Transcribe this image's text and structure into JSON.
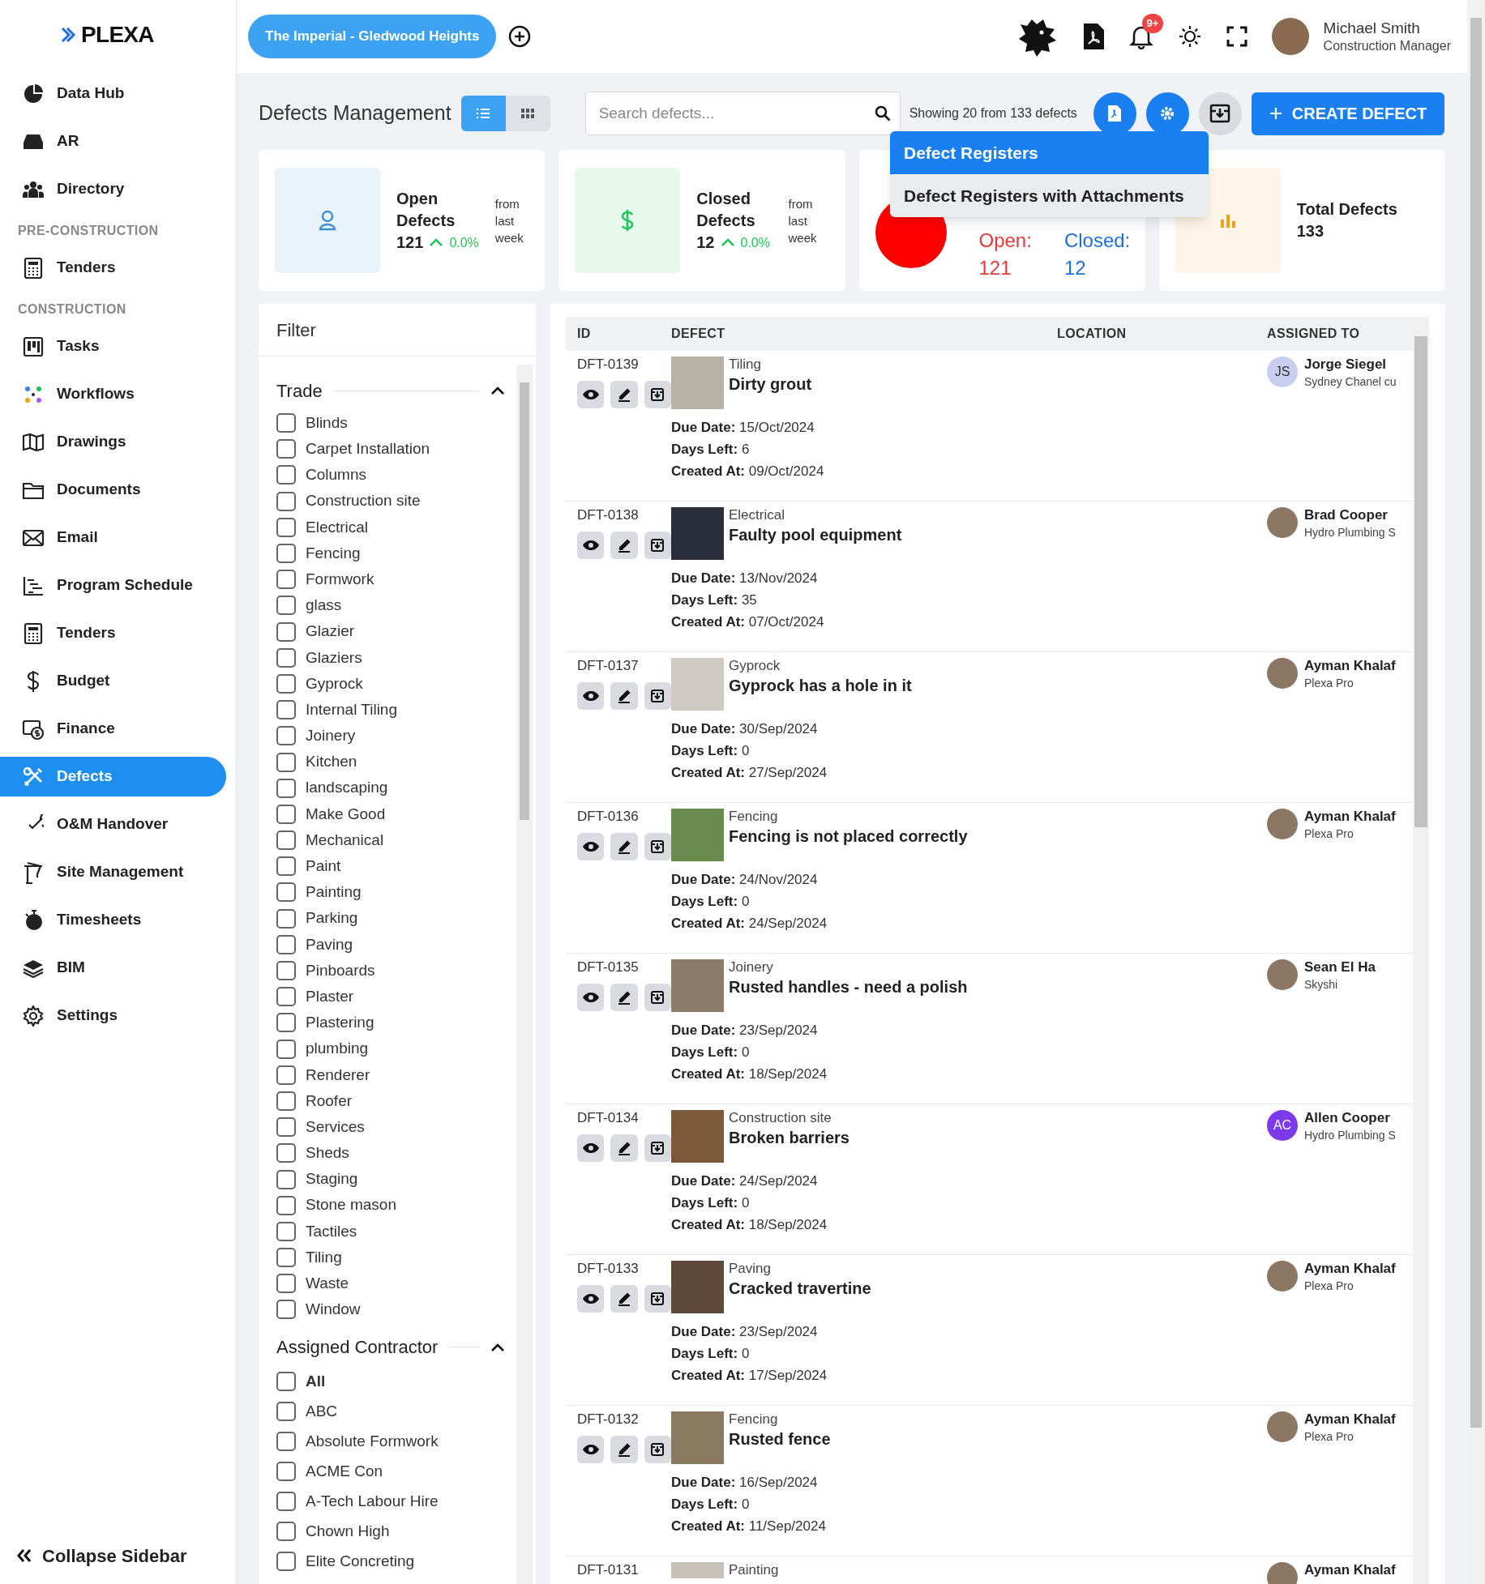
{
  "sidebar": {
    "logo": "PLEXA",
    "groups": [
      {
        "items": [
          {
            "label": "Data Hub",
            "selected": false
          },
          {
            "label": "AR",
            "selected": false
          },
          {
            "label": "Directory",
            "selected": false
          }
        ]
      },
      {
        "heading": "PRE-CONSTRUCTION",
        "items": [
          {
            "label": "Tenders",
            "selected": false
          }
        ]
      },
      {
        "heading": "CONSTRUCTION",
        "items": [
          {
            "label": "Tasks",
            "selected": false
          },
          {
            "label": "Workflows",
            "selected": false
          },
          {
            "label": "Drawings",
            "selected": false
          },
          {
            "label": "Documents",
            "selected": false
          },
          {
            "label": "Email",
            "selected": false
          },
          {
            "label": "Program Schedule",
            "selected": false
          },
          {
            "label": "Tenders",
            "selected": false
          },
          {
            "label": "Budget",
            "selected": false
          },
          {
            "label": "Finance",
            "selected": false
          },
          {
            "label": "Defects",
            "selected": true
          },
          {
            "label": "O&M Handover",
            "selected": false
          },
          {
            "label": "Site Management",
            "selected": false
          },
          {
            "label": "Timesheets",
            "selected": false
          },
          {
            "label": "BIM",
            "selected": false
          },
          {
            "label": "Settings",
            "selected": false
          }
        ]
      }
    ],
    "collapse": "Collapse Sidebar"
  },
  "topbar": {
    "project": "The Imperial - Gledwood Heights",
    "notifications": "9+",
    "user": {
      "name": "Michael Smith",
      "role": "Construction Manager"
    }
  },
  "page": {
    "title": "Defects Management",
    "views": [
      {
        "kind": "list",
        "selected": true
      },
      {
        "kind": "grid",
        "selected": false
      }
    ],
    "search": {
      "placeholder": "Search defects..."
    },
    "showing": "Showing 20 from 133 defects",
    "create": "CREATE DEFECT",
    "export_menu": [
      "Defect Registers",
      "Defect Registers with Attachments"
    ]
  },
  "stats": [
    {
      "kind": "trend",
      "title": "Open Defects",
      "value": "121",
      "change": "0.0%",
      "note": "from last week",
      "color": "#3b8fd6"
    },
    {
      "kind": "trend",
      "title": "Closed Defects",
      "value": "12",
      "change": "0.0%",
      "note": "from last week",
      "color": "#22c55e"
    },
    {
      "kind": "pie",
      "open_label": "Open:",
      "open_value": "121",
      "closed_label": "Closed:",
      "closed_value": "12"
    },
    {
      "kind": "total",
      "title": "Total Defects",
      "value": "133",
      "color": "#f0a020"
    }
  ],
  "filter": {
    "title": "Filter",
    "sections": [
      {
        "title": "Trade",
        "expanded": true,
        "options": [
          {
            "label": "Blinds",
            "checked": false
          },
          {
            "label": "Carpet Installation",
            "checked": false
          },
          {
            "label": "Columns",
            "checked": false
          },
          {
            "label": "Construction site",
            "checked": false
          },
          {
            "label": "Electrical",
            "checked": false
          },
          {
            "label": "Fencing",
            "checked": false
          },
          {
            "label": "Formwork",
            "checked": false
          },
          {
            "label": "glass",
            "checked": false
          },
          {
            "label": "Glazier",
            "checked": false
          },
          {
            "label": "Glaziers",
            "checked": false
          },
          {
            "label": "Gyprock",
            "checked": false
          },
          {
            "label": "Internal Tiling",
            "checked": false
          },
          {
            "label": "Joinery",
            "checked": false
          },
          {
            "label": "Kitchen",
            "checked": false
          },
          {
            "label": "landscaping",
            "checked": false
          },
          {
            "label": "Make Good",
            "checked": false
          },
          {
            "label": "Mechanical",
            "checked": false
          },
          {
            "label": "Paint",
            "checked": false
          },
          {
            "label": "Painting",
            "checked": false
          },
          {
            "label": "Parking",
            "checked": false
          },
          {
            "label": "Paving",
            "checked": false
          },
          {
            "label": "Pinboards",
            "checked": false
          },
          {
            "label": "Plaster",
            "checked": false
          },
          {
            "label": "Plastering",
            "checked": false
          },
          {
            "label": "plumbing",
            "checked": false
          },
          {
            "label": "Renderer",
            "checked": false
          },
          {
            "label": "Roofer",
            "checked": false
          },
          {
            "label": "Services",
            "checked": false
          },
          {
            "label": "Sheds",
            "checked": false
          },
          {
            "label": "Staging",
            "checked": false
          },
          {
            "label": "Stone mason",
            "checked": false
          },
          {
            "label": "Tactiles",
            "checked": false
          },
          {
            "label": "Tiling",
            "checked": false
          },
          {
            "label": "Waste",
            "checked": false
          },
          {
            "label": "Window",
            "checked": false
          }
        ]
      },
      {
        "title": "Assigned Contractor",
        "expanded": true,
        "options": [
          {
            "label": "All",
            "checked": false
          },
          {
            "label": "ABC",
            "checked": false
          },
          {
            "label": "Absolute Formwork",
            "checked": false
          },
          {
            "label": "ACME Con",
            "checked": false
          },
          {
            "label": "A-Tech Labour Hire",
            "checked": false
          },
          {
            "label": "Chown High",
            "checked": false
          },
          {
            "label": "Elite Concreting",
            "checked": false
          }
        ]
      }
    ]
  },
  "table": {
    "columns": [
      "ID",
      "DEFECT",
      "LOCATION",
      "ASSIGNED TO"
    ],
    "rows": [
      {
        "id": "DFT-0139",
        "trade": "Tiling",
        "title": "Dirty grout",
        "details": [
          {
            "label": "Due Date:",
            "value": "15/Oct/2024"
          },
          {
            "label": "Days Left:",
            "value": "6"
          },
          {
            "label": "Created At:",
            "value": "09/Oct/2024"
          }
        ],
        "assignee": {
          "name": "Jorge Siegel",
          "company": "Sydney Chanel cu",
          "initials": "JS",
          "color": "#c9cdf0"
        }
      },
      {
        "id": "DFT-0138",
        "trade": "Electrical",
        "title": "Faulty pool equipment",
        "details": [
          {
            "label": "Due Date:",
            "value": "13/Nov/2024"
          },
          {
            "label": "Days Left:",
            "value": "35"
          },
          {
            "label": "Created At:",
            "value": "07/Oct/2024"
          }
        ],
        "assignee": {
          "name": "Brad Cooper",
          "company": "Hydro Plumbing S"
        }
      },
      {
        "id": "DFT-0137",
        "trade": "Gyprock",
        "title": "Gyprock has a hole in it",
        "details": [
          {
            "label": "Due Date:",
            "value": "30/Sep/2024"
          },
          {
            "label": "Days Left:",
            "value": "0"
          },
          {
            "label": "Created At:",
            "value": "27/Sep/2024"
          }
        ],
        "assignee": {
          "name": "Ayman Khalaf",
          "company": "Plexa Pro"
        }
      },
      {
        "id": "DFT-0136",
        "trade": "Fencing",
        "title": "Fencing is not placed correctly",
        "details": [
          {
            "label": "Due Date:",
            "value": "24/Nov/2024"
          },
          {
            "label": "Days Left:",
            "value": "0"
          },
          {
            "label": "Created At:",
            "value": "24/Sep/2024"
          }
        ],
        "assignee": {
          "name": "Ayman Khalaf",
          "company": "Plexa Pro"
        }
      },
      {
        "id": "DFT-0135",
        "trade": "Joinery",
        "title": "Rusted handles - need a polish",
        "details": [
          {
            "label": "Due Date:",
            "value": "23/Sep/2024"
          },
          {
            "label": "Days Left:",
            "value": "0"
          },
          {
            "label": "Created At:",
            "value": "18/Sep/2024"
          }
        ],
        "assignee": {
          "name": "Sean El Ha",
          "company": "Skyshi"
        }
      },
      {
        "id": "DFT-0134",
        "trade": "Construction site",
        "title": "Broken barriers",
        "details": [
          {
            "label": "Due Date:",
            "value": "24/Sep/2024"
          },
          {
            "label": "Days Left:",
            "value": "0"
          },
          {
            "label": "Created At:",
            "value": "18/Sep/2024"
          }
        ],
        "assignee": {
          "name": "Allen Cooper",
          "company": "Hydro Plumbing S",
          "initials": "AC",
          "color": "#7c3aed"
        }
      },
      {
        "id": "DFT-0133",
        "trade": "Paving",
        "title": "Cracked travertine",
        "details": [
          {
            "label": "Due Date:",
            "value": "23/Sep/2024"
          },
          {
            "label": "Days Left:",
            "value": "0"
          },
          {
            "label": "Created At:",
            "value": "17/Sep/2024"
          }
        ],
        "assignee": {
          "name": "Ayman Khalaf",
          "company": "Plexa Pro"
        }
      },
      {
        "id": "DFT-0132",
        "trade": "Fencing",
        "title": "Rusted fence",
        "details": [
          {
            "label": "Due Date:",
            "value": "16/Sep/2024"
          },
          {
            "label": "Days Left:",
            "value": "0"
          },
          {
            "label": "Created At:",
            "value": "11/Sep/2024"
          }
        ],
        "assignee": {
          "name": "Ayman Khalaf",
          "company": "Plexa Pro"
        }
      },
      {
        "id": "DFT-0131",
        "trade": "Painting",
        "assignee": {
          "name": "Ayman Khalaf"
        }
      }
    ]
  }
}
